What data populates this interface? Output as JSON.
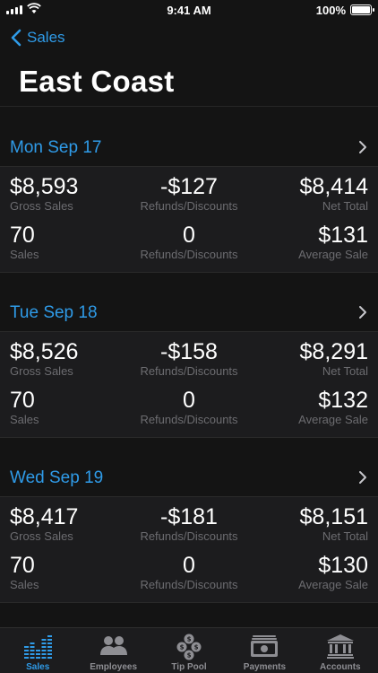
{
  "status_bar": {
    "time": "9:41 AM",
    "battery": "100%"
  },
  "nav": {
    "back_label": "Sales",
    "title": "East Coast"
  },
  "days": [
    {
      "date": "Mon Sep 17",
      "gross": "$8,593",
      "refunds": "-$127",
      "net": "$8,414",
      "sales_count": "70",
      "refund_count": "0",
      "average": "$131"
    },
    {
      "date": "Tue Sep 18",
      "gross": "$8,526",
      "refunds": "-$158",
      "net": "$8,291",
      "sales_count": "70",
      "refund_count": "0",
      "average": "$132"
    },
    {
      "date": "Wed Sep 19",
      "gross": "$8,417",
      "refunds": "-$181",
      "net": "$8,151",
      "sales_count": "70",
      "refund_count": "0",
      "average": "$130"
    }
  ],
  "labels": {
    "gross": "Gross Sales",
    "refunds": "Refunds/Discounts",
    "net": "Net Total",
    "sales": "Sales",
    "refund_count": "Refunds/Discounts",
    "average": "Average Sale"
  },
  "tabs": [
    {
      "label": "Sales",
      "icon": "bar-chart-icon",
      "active": true
    },
    {
      "label": "Employees",
      "icon": "employees-icon",
      "active": false
    },
    {
      "label": "Tip Pool",
      "icon": "tip-pool-icon",
      "active": false
    },
    {
      "label": "Payments",
      "icon": "payments-icon",
      "active": false
    },
    {
      "label": "Accounts",
      "icon": "bank-icon",
      "active": false
    }
  ],
  "colors": {
    "accent": "#2f9be8",
    "background": "#141414",
    "card": "#1c1c1e",
    "muted": "#6c6c70"
  }
}
